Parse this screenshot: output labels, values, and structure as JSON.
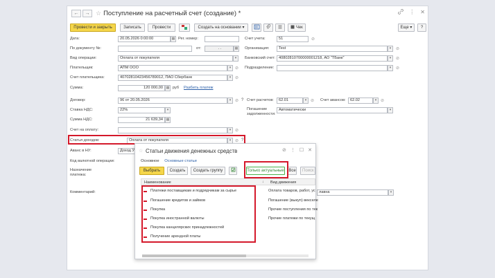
{
  "window": {
    "title": "Поступление на расчетный счет (создание) *",
    "nav_back": "←",
    "nav_forward": "→",
    "star": "☆",
    "link_icon": "link-icon",
    "more": "⋮",
    "close": "✕"
  },
  "toolbar": {
    "post_close": "Провести и закрыть",
    "save": "Записать",
    "post": "Провести",
    "create_based": "Создать на основании",
    "check": "Чек",
    "more": "Еще",
    "help": "?"
  },
  "form": {
    "date_label": "Дата:",
    "date_value": "20.05.2026  0:00:00",
    "reg_label": "Рег. номер:",
    "account_label": "Счет учета:",
    "account_value": "51",
    "doc_label": "По документу №:",
    "from_label": "от:",
    "from_value": ". .",
    "org_label": "Организация:",
    "org_value": "Test",
    "op_label": "Вид операции:",
    "op_value": "Оплата от покупателя",
    "bank_label": "Банковский счет:",
    "bank_value": "40802810700000001218, АО \"ТБанк\"",
    "payer_label": "Плательщик:",
    "payer_value": "АПМ ООО",
    "division_label": "Подразделение:",
    "payer_acc_label": "Счет плательщика:",
    "payer_acc_value": "40702810423456789012, ПАО Сбербанк",
    "sum_label": "Сумма:",
    "sum_value": "120 000,00",
    "currency": "руб",
    "split_link": "Разбить платеж",
    "contract_label": "Договор:",
    "contract_value": "96 от 20.05.2026",
    "settle_label": "Счет расчетов:",
    "settle_value": "62.01",
    "advance_label": "Счет авансов:",
    "advance_value": "62.02",
    "vat_rate_label": "Ставка НДС:",
    "vat_rate_value": "22%",
    "debt_label_1": "Погашение",
    "debt_label_2": "задолженности:",
    "debt_value": "Автоматически",
    "vat_sum_label": "Сумма НДС:",
    "vat_sum_value": "21 639,34",
    "invoice_label": "Счет на оплату:",
    "income_label": "Статья доходов:",
    "income_value": "Оплата от покупателя",
    "advance_nu_label": "Аванс в НУ:",
    "advance_nu_value": "Доход УСН",
    "currency_op_label": "Код валютной операции:",
    "purpose_label_1": "Назначение",
    "purpose_label_2": "платежа:",
    "comment_label": "Комментарий:",
    "comment_value": "лавна"
  },
  "dialog": {
    "title": "Статьи движения денежных средств",
    "tab_main": "Основное",
    "tab_articles": "Основные статьи",
    "select": "Выбрать",
    "create": "Создать",
    "create_group": "Создать группу",
    "only_actual": "Только актуальные",
    "all": "Все",
    "search_placeholder": "Поиск (",
    "col_name": "Наименование",
    "col_kind": "Вид движения",
    "sort_arrow": "↓",
    "rows": [
      {
        "name": "Платежи поставщикам и подрядчикам за сырье",
        "kind": "Оплата товаров, работ, ус"
      },
      {
        "name": "Погашение кредитов и займов",
        "kind": "Погашение (выкуп) векселе"
      },
      {
        "name": "Покупка",
        "kind": "Прочие поступления по тек"
      },
      {
        "name": "Покупка иностранной валюты",
        "kind": "Прочие платежи по текущ"
      },
      {
        "name": "Покупка канцелярских принадлежностей",
        "kind": ""
      },
      {
        "name": "Получение арендной платы",
        "kind": ""
      }
    ]
  },
  "colors": {
    "highlight": "#d4182a",
    "primary": "#f5d64a",
    "link": "#2a5ea8",
    "green": "#49b04a"
  }
}
